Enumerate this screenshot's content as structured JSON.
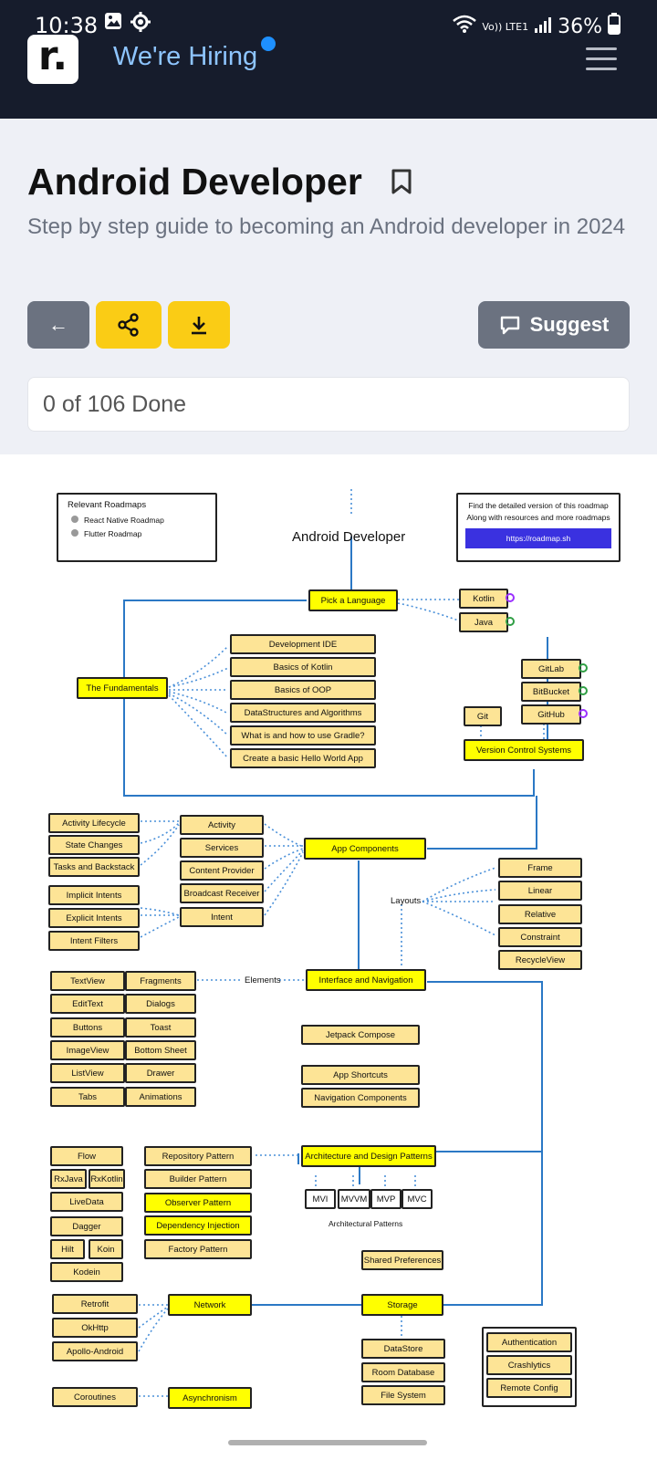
{
  "status_bar": {
    "time": "10:38",
    "signal": "Vo)) LTE1",
    "battery": "36%"
  },
  "header": {
    "logo": "r.",
    "hiring": "We're Hiring"
  },
  "page": {
    "title": "Android Developer",
    "subtitle": "Step by step guide to becoming an Android developer in 2024",
    "back_label": "←",
    "suggest_label": "Suggest",
    "progress": "0 of 106 Done"
  },
  "roadmap": {
    "title": "Android Developer",
    "relevant": {
      "heading": "Relevant Roadmaps",
      "items": [
        "React Native Roadmap",
        "Flutter Roadmap"
      ]
    },
    "detail": {
      "line1": "Find the detailed version of this roadmap",
      "line2": "Along with resources and more roadmaps",
      "link": "https://roadmap.sh"
    },
    "language": {
      "label": "Pick a Language",
      "kotlin": "Kotlin",
      "java": "Java"
    },
    "fundamentals": {
      "label": "The Fundamentals",
      "items": [
        "Development IDE",
        "Basics of Kotlin",
        "Basics of OOP",
        "DataStructures and Algorithms",
        "What is and how to use Gradle?",
        "Create a basic Hello World App"
      ]
    },
    "vcs": {
      "label": "Version Control Systems",
      "git": "Git",
      "items": [
        "GitLab",
        "BitBucket",
        "GitHub"
      ]
    },
    "components": {
      "label": "App Components",
      "items": [
        "Activity",
        "Services",
        "Content Provider",
        "Broadcast Receiver",
        "Intent"
      ],
      "left": [
        "Activity Lifecycle",
        "State Changes",
        "Tasks and Backstack",
        "Implicit Intents",
        "Explicit Intents",
        "Intent Filters"
      ]
    },
    "layouts": {
      "label": "Layouts",
      "items": [
        "Frame",
        "Linear",
        "Relative",
        "Constraint",
        "RecycleView"
      ]
    },
    "interface": {
      "label": "Interface and Navigation",
      "elements": "Elements",
      "col1": [
        "TextView",
        "EditText",
        "Buttons",
        "ImageView",
        "ListView",
        "Tabs"
      ],
      "col2": [
        "Fragments",
        "Dialogs",
        "Toast",
        "Bottom Sheet",
        "Drawer",
        "Animations"
      ],
      "right": [
        "Jetpack Compose",
        "App Shortcuts",
        "Navigation Components"
      ]
    },
    "architecture": {
      "label": "Architecture and Design Patterns",
      "patterns": [
        "Repository Pattern",
        "Builder Pattern",
        "Observer Pattern",
        "Dependency Injection",
        "Factory Pattern"
      ],
      "left": [
        "Flow",
        "RxJava",
        "RxKotlin",
        "LiveData",
        "Dagger",
        "Hilt",
        "Koin",
        "Kodein"
      ],
      "arch": [
        "MVI",
        "MVVM",
        "MVP",
        "MVC"
      ],
      "arch_label": "Architectural Patterns",
      "shared": "Shared Preferences"
    },
    "network": {
      "label": "Network",
      "items": [
        "Retrofit",
        "OkHttp",
        "Apollo-Android"
      ]
    },
    "storage": {
      "label": "Storage",
      "items": [
        "DataStore",
        "Room Database",
        "File System"
      ]
    },
    "firebase": [
      "Authentication",
      "Crashlytics",
      "Remote Config"
    ],
    "async": {
      "label": "Asynchronism",
      "coroutines": "Coroutines"
    }
  }
}
